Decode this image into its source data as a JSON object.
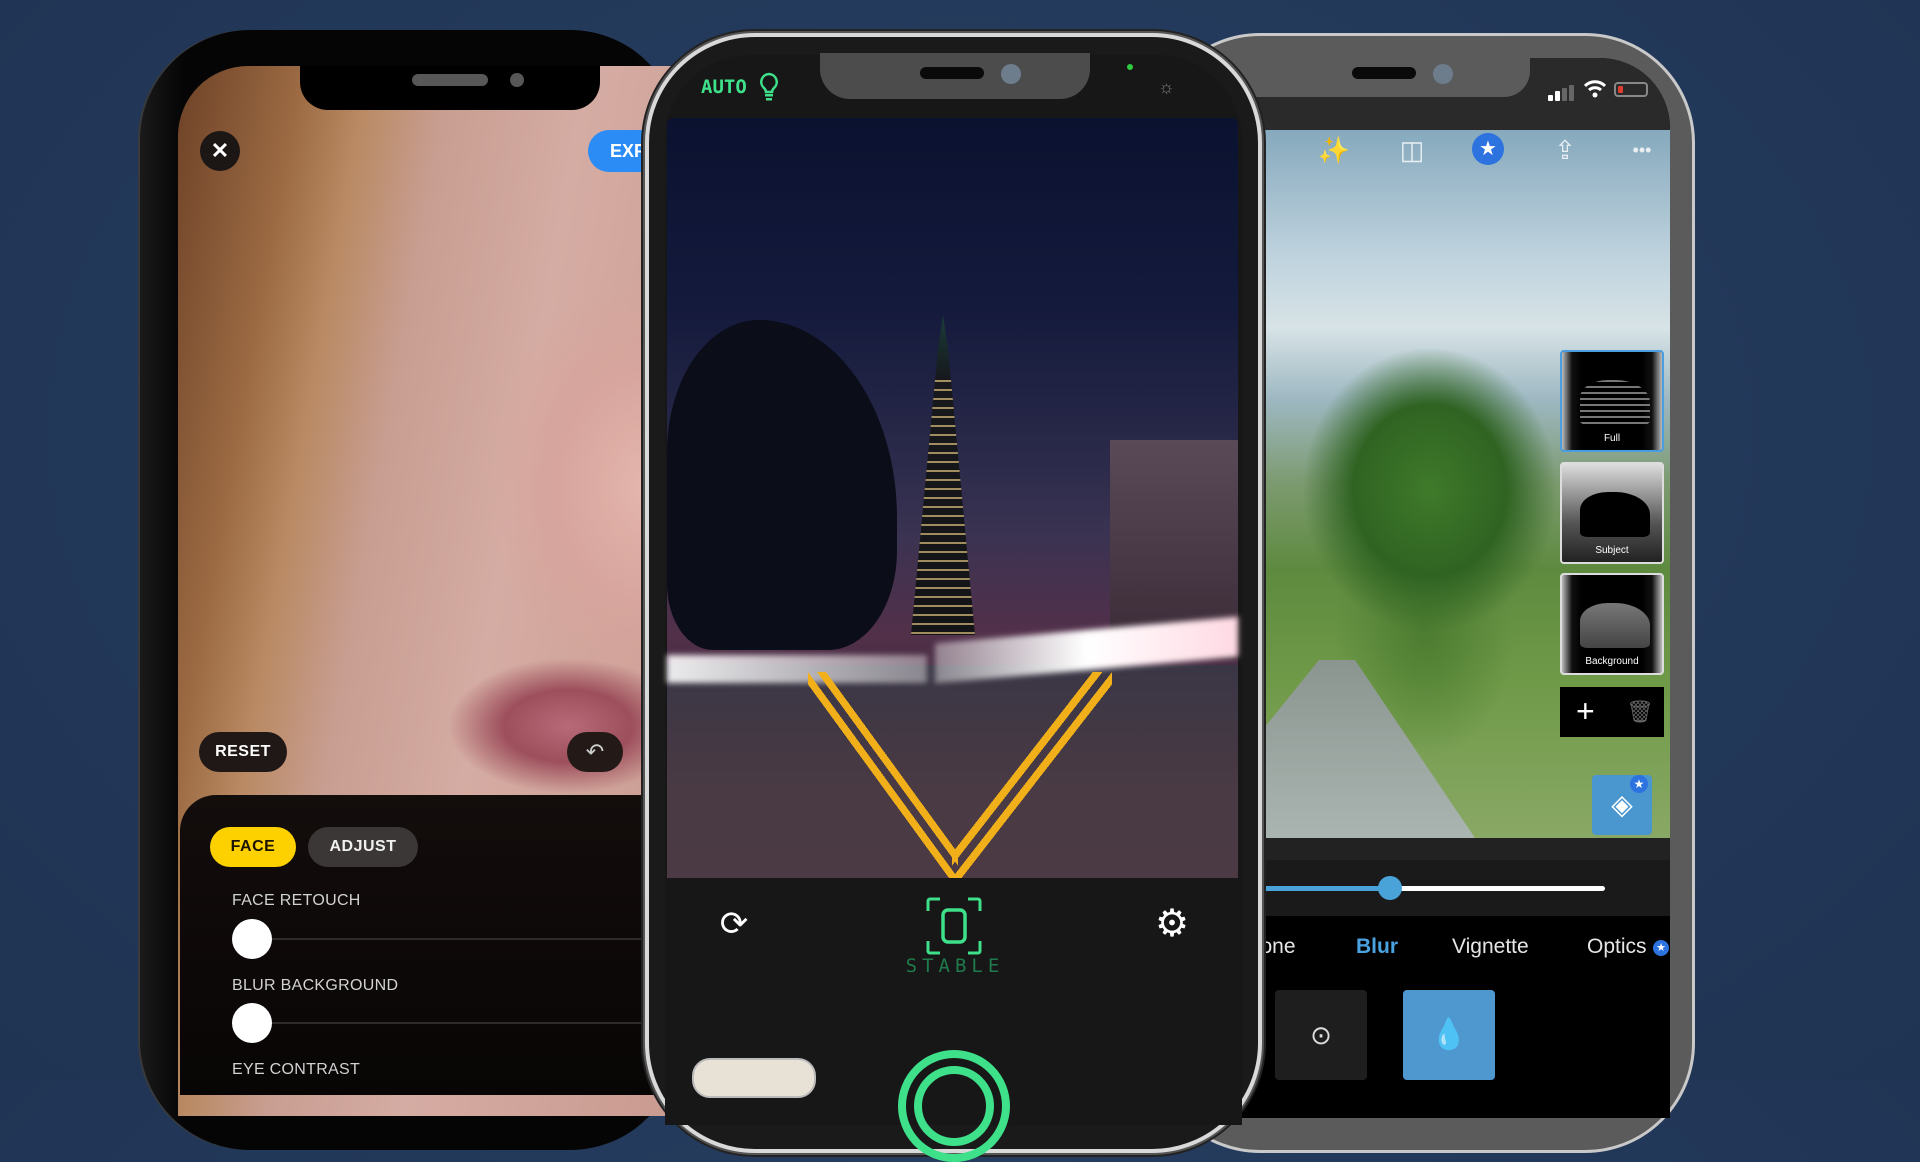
{
  "colors": {
    "background": "#23395a",
    "facetune_accent": "#fdd100",
    "export_blue": "#2a8cf4",
    "camera_green": "#3ee08a",
    "lightroom_blue": "#4a96cf",
    "premium_star": "#2c73e0"
  },
  "left_phone": {
    "icons": {
      "close": "close-icon",
      "undo": "undo-icon"
    },
    "close_symbol": "✕",
    "export_label": "EXP",
    "reset_label": "RESET",
    "undo_symbol": "↶",
    "tabs": [
      {
        "label": "FACE",
        "active": true
      },
      {
        "label": "ADJUST",
        "active": false
      }
    ],
    "sliders": [
      {
        "label": "FACE RETOUCH",
        "value": 0
      },
      {
        "label": "BLUR BACKGROUND",
        "value": 0
      },
      {
        "label": "EYE CONTRAST"
      }
    ]
  },
  "middle_phone": {
    "flash_mode": "AUTO",
    "icons": {
      "flash": "lightbulb-icon",
      "brightness": "brightness-icon",
      "rotate": "rotate-camera-icon",
      "stabilizer": "stabilizer-icon",
      "settings": "settings-gear-icon",
      "shutter": "shutter-button-icon"
    },
    "bulb_symbol": "💡",
    "brightness_symbol": "☼",
    "rotate_symbol": "⟳",
    "settings_symbol": "⚙",
    "stabilizer_label": "STABLE"
  },
  "right_phone": {
    "status": {
      "signal_bars": 2,
      "battery_low": true
    },
    "toolbar": [
      {
        "name": "auto-enhance",
        "symbol": "✨"
      },
      {
        "name": "compare",
        "symbol": "◫"
      },
      {
        "name": "premium",
        "symbol": "★"
      },
      {
        "name": "share",
        "symbol": "⇪"
      },
      {
        "name": "more",
        "symbol": "•••"
      }
    ],
    "masks": [
      {
        "label": "Full",
        "selected": true
      },
      {
        "label": "Subject",
        "selected": false
      },
      {
        "label": "Background",
        "selected": false
      }
    ],
    "mask_actions": {
      "add_symbol": "+",
      "delete_symbol": "🗑"
    },
    "layers_symbol": "◈",
    "star_symbol": "★",
    "blur_amount_fraction": 0.5,
    "tabs": [
      {
        "label": "Tone",
        "active": false
      },
      {
        "label": "Blur",
        "active": true
      },
      {
        "label": "Vignette",
        "active": false
      },
      {
        "label": "Optics",
        "active": false,
        "premium": true
      }
    ],
    "blur_types": [
      {
        "name": "radial",
        "symbol": "⊙",
        "selected": false
      },
      {
        "name": "lens",
        "symbol": "💧",
        "selected": true
      }
    ]
  }
}
